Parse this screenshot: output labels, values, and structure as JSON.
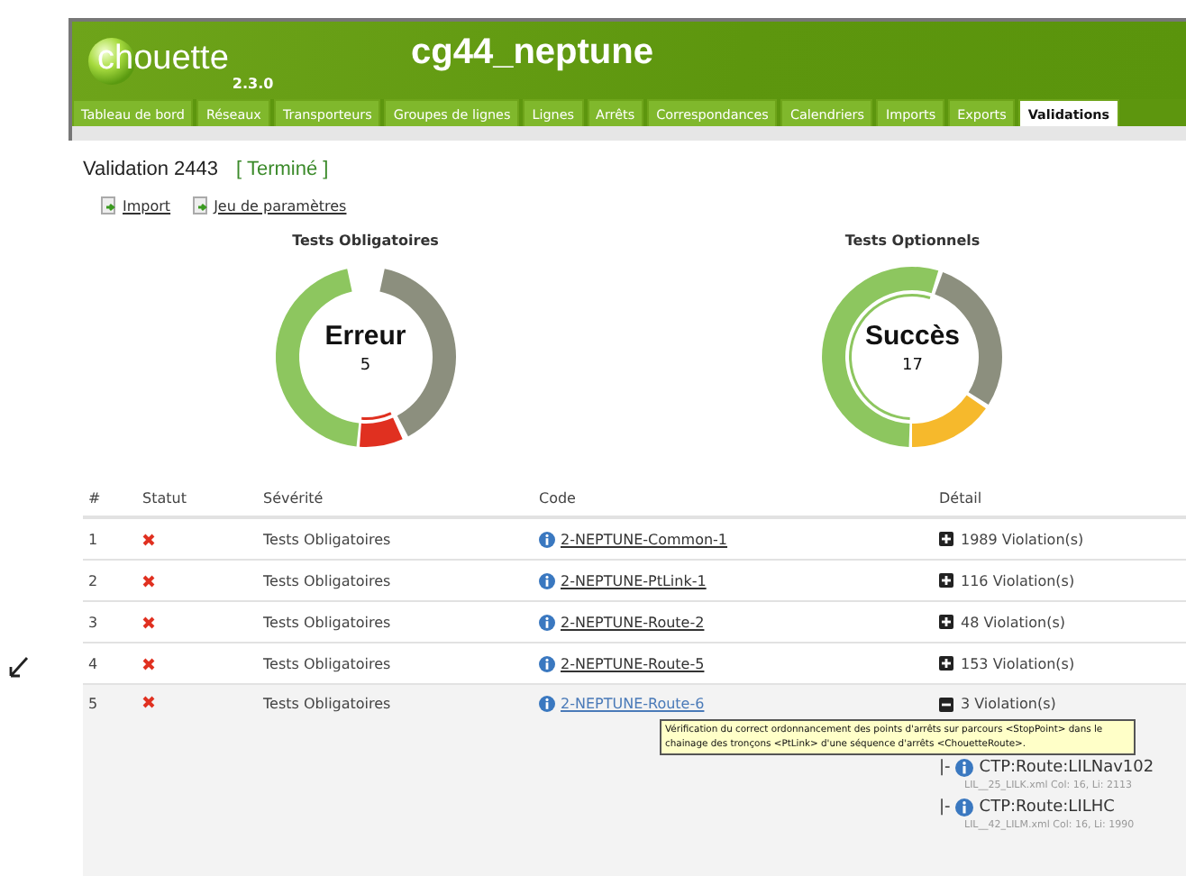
{
  "header": {
    "logo": "chouette",
    "version": "2.3.0",
    "title": "cg44_neptune"
  },
  "tabs": [
    {
      "label": "Tableau de bord",
      "selected": false
    },
    {
      "label": "Réseaux",
      "selected": false
    },
    {
      "label": "Transporteurs",
      "selected": false
    },
    {
      "label": "Groupes de lignes",
      "selected": false
    },
    {
      "label": "Lignes",
      "selected": false
    },
    {
      "label": "Arrêts",
      "selected": false
    },
    {
      "label": "Correspondances",
      "selected": false
    },
    {
      "label": "Calendriers",
      "selected": false
    },
    {
      "label": "Imports",
      "selected": false
    },
    {
      "label": "Exports",
      "selected": false
    },
    {
      "label": "Validations",
      "selected": true
    }
  ],
  "validation": {
    "title": "Validation 2443",
    "status": "[ Terminé ]"
  },
  "links": [
    "Import",
    "Jeu de paramètres"
  ],
  "charts": [
    {
      "title": "Tests Obligatoires",
      "result": "Erreur",
      "count": "5",
      "kind": "error"
    },
    {
      "title": "Tests Optionnels",
      "result": "Succès",
      "count": "17",
      "kind": "success"
    }
  ],
  "table": {
    "columns": [
      "#",
      "Statut",
      "Sévérité",
      "Code",
      "Détail"
    ],
    "rows": [
      {
        "index": "1",
        "kind": "error",
        "severity": "Tests Obligatoires",
        "code": "2-NEPTUNE-Common-1",
        "detail": "1989 Violation(s)",
        "expanded": false,
        "hovered": false
      },
      {
        "index": "2",
        "kind": "error",
        "severity": "Tests Obligatoires",
        "code": "2-NEPTUNE-PtLink-1",
        "detail": "116 Violation(s)",
        "expanded": false,
        "hovered": false
      },
      {
        "index": "3",
        "kind": "error",
        "severity": "Tests Obligatoires",
        "code": "2-NEPTUNE-Route-2",
        "detail": "48 Violation(s)",
        "expanded": false,
        "hovered": false
      },
      {
        "index": "4",
        "kind": "error",
        "severity": "Tests Obligatoires",
        "code": "2-NEPTUNE-Route-5",
        "detail": "153 Violation(s)",
        "expanded": false,
        "hovered": false
      },
      {
        "index": "5",
        "kind": "error",
        "severity": "Tests Obligatoires",
        "code": "2-NEPTUNE-Route-6",
        "detail": "3 Violation(s)",
        "expanded": true,
        "hovered": true,
        "tooltip": "Vérification du correct ordonnancement des points d'arrêts sur parcours <StopPoint> dans le chainage des tronçons <PtLink> d'une séquence d'arrêts <ChouetteRoute>.",
        "violations": [
          {
            "prefix": "|-",
            "object": "CTP:Route:LILNav102",
            "location": "LIL__25_LILK.xml Col: 16, Li: 2113"
          },
          {
            "prefix": "|-",
            "object": "CTP:Route:LILHC",
            "location": "LIL__42_LILM.xml Col: 16, Li: 1990"
          }
        ]
      }
    ]
  }
}
